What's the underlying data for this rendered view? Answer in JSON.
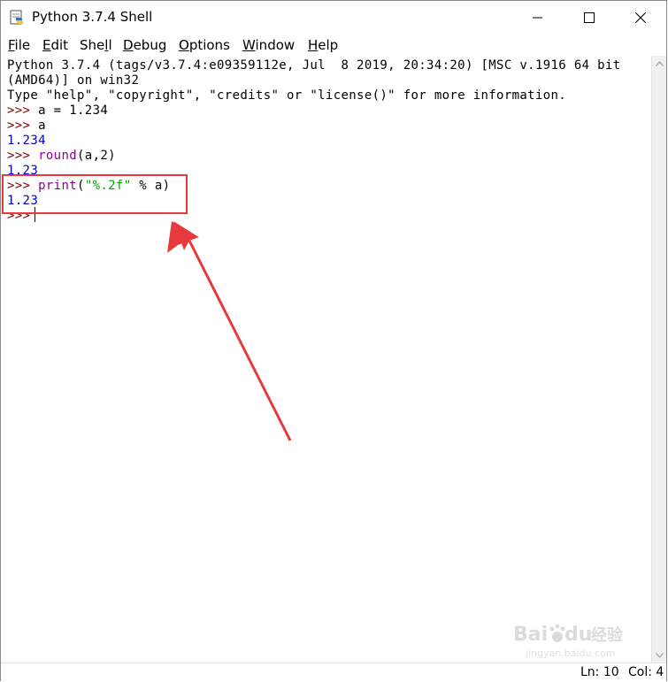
{
  "window": {
    "title": "Python 3.7.4 Shell",
    "app_icon": "python-idle-icon",
    "buttons": [
      "minimize-icon",
      "maximize-icon",
      "close-icon"
    ]
  },
  "menu": [
    {
      "pre": "",
      "u": "F",
      "post": "ile"
    },
    {
      "pre": "",
      "u": "E",
      "post": "dit"
    },
    {
      "pre": "She",
      "u": "l",
      "post": "l"
    },
    {
      "pre": "",
      "u": "D",
      "post": "ebug"
    },
    {
      "pre": "",
      "u": "O",
      "post": "ptions"
    },
    {
      "pre": "",
      "u": "W",
      "post": "indow"
    },
    {
      "pre": "",
      "u": "H",
      "post": "elp"
    }
  ],
  "shell": {
    "banner1": "Python 3.7.4 (tags/v3.7.4:e09359112e, Jul  8 2019, 20:34:20) [MSC v.1916 64 bit",
    "banner2": "(AMD64)] on win32",
    "banner3": "Type \"help\", \"copyright\", \"credits\" or \"license()\" for more information.",
    "prompt": ">>> ",
    "cmd1": "a = 1.234",
    "cmd2": "a",
    "out2": "1.234",
    "cmd3_func": "round",
    "cmd3_args": "(a,2)",
    "out3": "1.23",
    "cmd4_func": "print",
    "cmd4_open": "(",
    "cmd4_str": "\"%.2f\"",
    "cmd4_rest": " % a)",
    "out4": "1.23",
    "last_prompt": ">>> "
  },
  "status": {
    "line": "Ln: 10",
    "col": "Col: 4"
  },
  "annotation": {
    "color": "#e8393d",
    "shape": "highlight-box-and-arrow"
  },
  "watermark": {
    "logo": "baidu-paw-icon",
    "text": "Baidu经验",
    "sub": "jingyan.baidu.com"
  },
  "colors": {
    "prompt": "#7f0000",
    "result": "#0000cc",
    "builtin": "#900090",
    "string": "#00aa00"
  }
}
